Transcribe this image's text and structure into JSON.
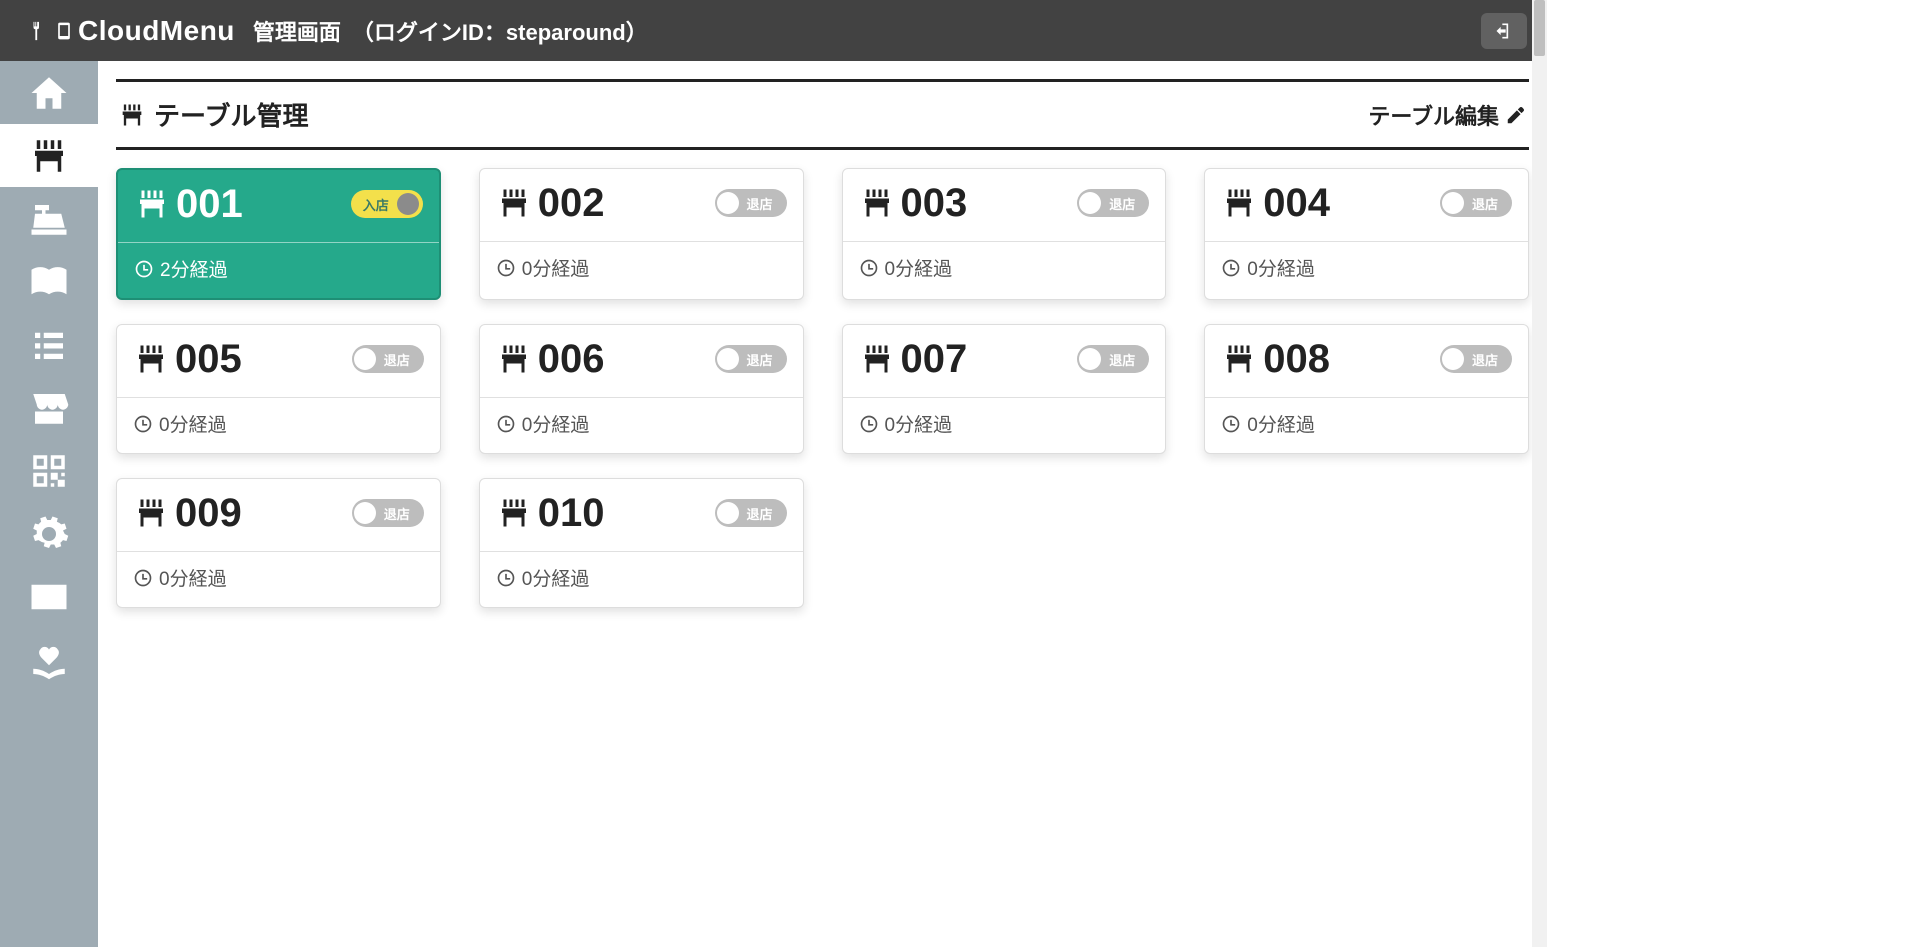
{
  "header": {
    "brand": "CloudMenu",
    "title": "管理画面　（ログインID：steparound）"
  },
  "page": {
    "title": "テーブル管理",
    "edit_label": "テーブル編集"
  },
  "sidebar": {
    "active_index": 1
  },
  "status_labels": {
    "in": "入店",
    "out": "退店"
  },
  "tables": [
    {
      "number": "001",
      "elapsed": "2分経過",
      "occupied": true
    },
    {
      "number": "002",
      "elapsed": "0分経過",
      "occupied": false
    },
    {
      "number": "003",
      "elapsed": "0分経過",
      "occupied": false
    },
    {
      "number": "004",
      "elapsed": "0分経過",
      "occupied": false
    },
    {
      "number": "005",
      "elapsed": "0分経過",
      "occupied": false
    },
    {
      "number": "006",
      "elapsed": "0分経過",
      "occupied": false
    },
    {
      "number": "007",
      "elapsed": "0分経過",
      "occupied": false
    },
    {
      "number": "008",
      "elapsed": "0分経過",
      "occupied": false
    },
    {
      "number": "009",
      "elapsed": "0分経過",
      "occupied": false
    },
    {
      "number": "010",
      "elapsed": "0分経過",
      "occupied": false
    }
  ]
}
